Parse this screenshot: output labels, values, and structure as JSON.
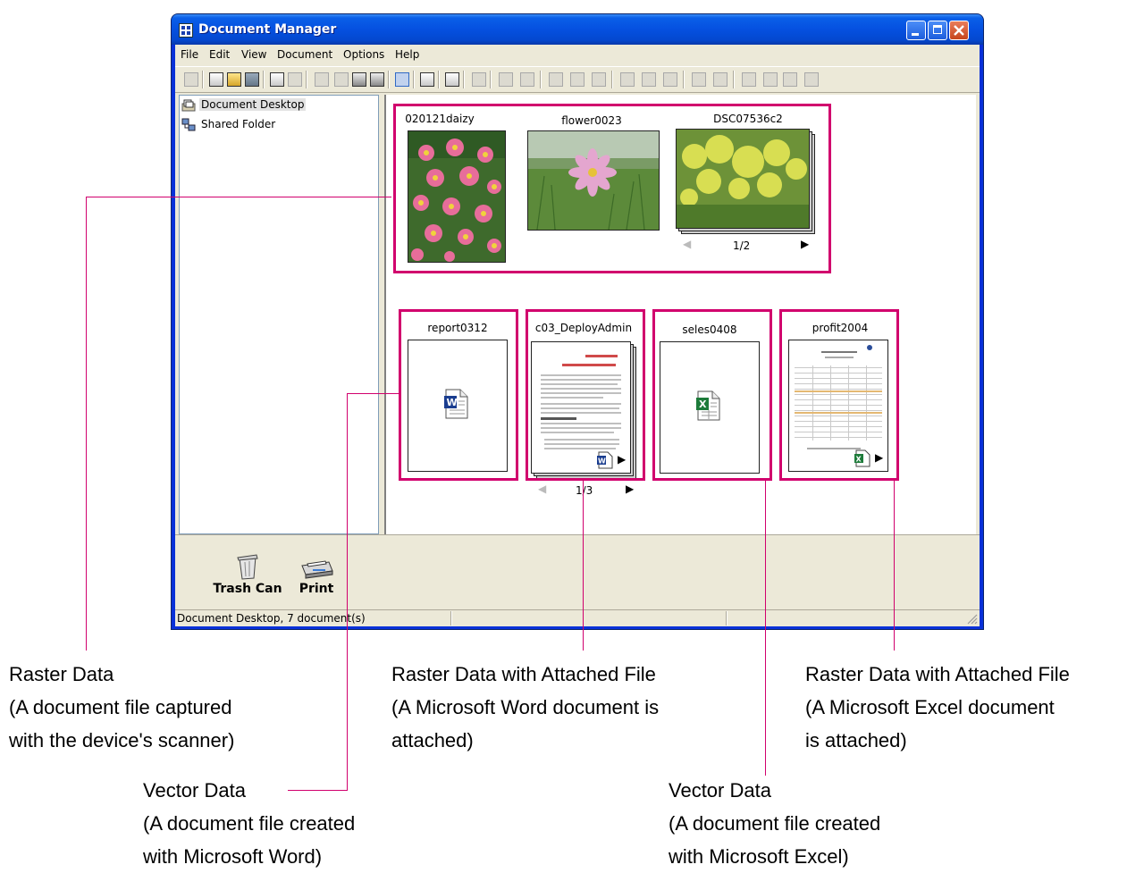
{
  "window": {
    "title": "Document Manager",
    "buttons": {
      "minimize": "minimize-icon",
      "maximize": "maximize-icon",
      "close": "close-icon"
    }
  },
  "menu": [
    "File",
    "Edit",
    "View",
    "Document",
    "Options",
    "Help"
  ],
  "tree": [
    {
      "label": "Document Desktop",
      "icon": "document-desktop-icon",
      "selected": true
    },
    {
      "label": "Shared Folder",
      "icon": "shared-folder-icon",
      "selected": false
    }
  ],
  "documents": {
    "d1": {
      "name": "020121daizy"
    },
    "d2": {
      "name": "flower0023"
    },
    "d3": {
      "name": "DSC07536c2",
      "pager": "1/2"
    },
    "d4": {
      "name": "report0312"
    },
    "d5": {
      "name": "c03_DeployAdmin",
      "pager": "1/3"
    },
    "d6": {
      "name": "seles0408"
    },
    "d7": {
      "name": "profit2004"
    }
  },
  "bottom_tools": {
    "trash": "Trash Can",
    "print": "Print"
  },
  "status": "Document Desktop, 7 document(s)",
  "callouts": {
    "raster": [
      "Raster Data",
      "(A document file captured",
      "with the device's scanner)"
    ],
    "raster_word": [
      "Raster Data with Attached File",
      "(A Microsoft Word document is",
      "attached)"
    ],
    "raster_excel": [
      "Raster Data with Attached File",
      "(A Microsoft Excel document",
      "is attached)"
    ],
    "vector_word": [
      "Vector Data",
      "(A document file created",
      "with Microsoft Word)"
    ],
    "vector_excel": [
      "Vector Data",
      "(A document file created",
      "with Microsoft Excel)"
    ]
  },
  "colors": {
    "highlight": "#d1006d",
    "titlebar": "#0550e0",
    "word": "#1a3d8f",
    "excel": "#1d7b3a"
  }
}
